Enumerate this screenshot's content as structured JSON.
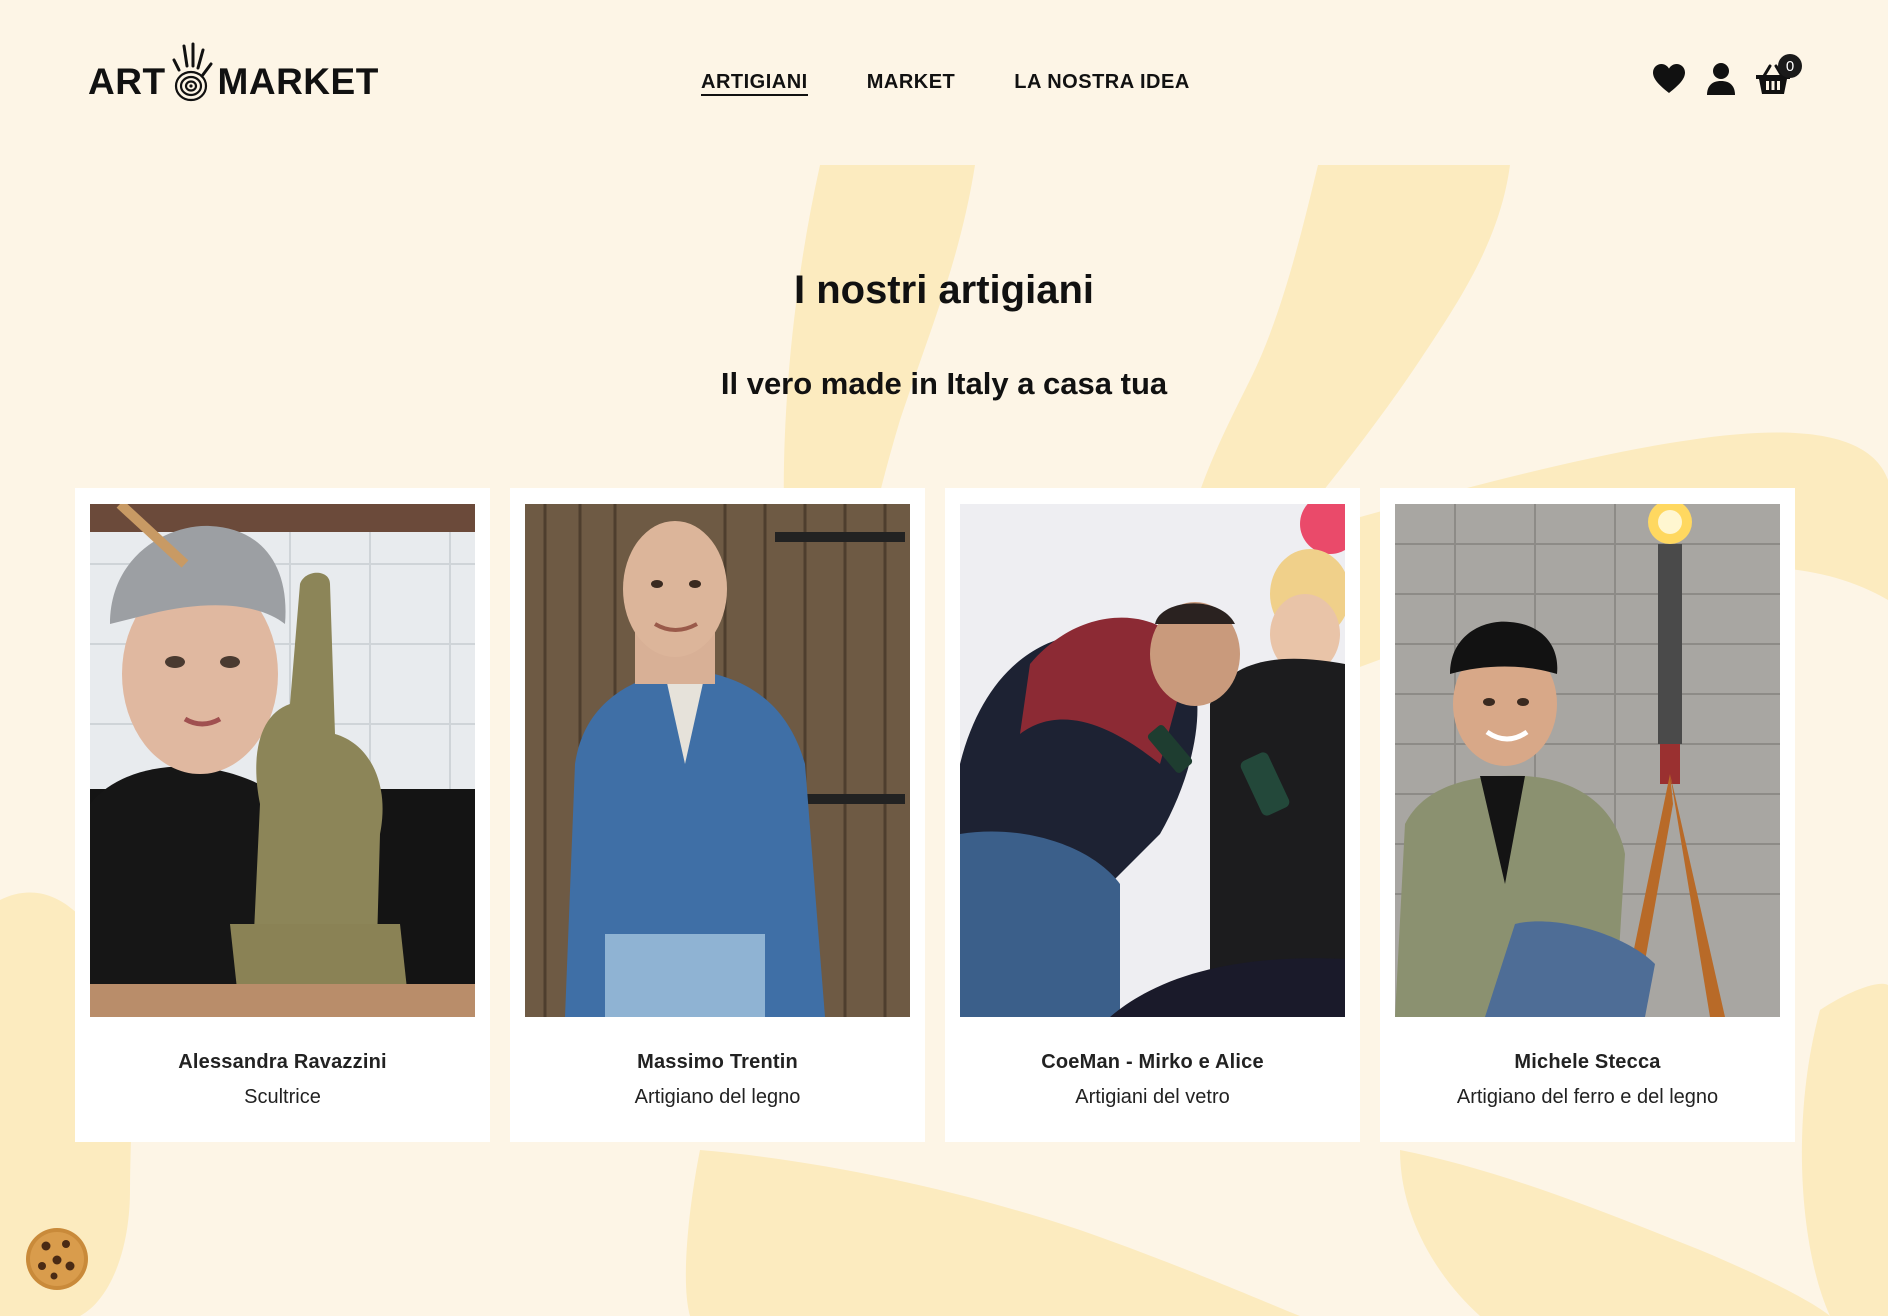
{
  "brand": {
    "left": "ART",
    "right": "MARKET"
  },
  "nav": {
    "items": [
      {
        "label": "ARTIGIANI",
        "active": true
      },
      {
        "label": "MARKET",
        "active": false
      },
      {
        "label": "LA NOSTRA IDEA",
        "active": false
      }
    ]
  },
  "header_icons": {
    "wishlist": "heart-icon",
    "account": "user-icon",
    "cart": "basket-icon",
    "cart_count": "0"
  },
  "hero": {
    "title": "I nostri artigiani",
    "subtitle": "Il vero made in Italy a casa tua"
  },
  "artisans": [
    {
      "name": "Alessandra Ravazzini",
      "role": "Scultrice"
    },
    {
      "name": "Massimo Trentin",
      "role": "Artigiano del legno"
    },
    {
      "name": "CoeMan - Mirko e Alice",
      "role": "Artigiani del vetro"
    },
    {
      "name": "Michele Stecca",
      "role": "Artigiano del ferro e del legno"
    }
  ],
  "colors": {
    "background": "#fdf5e6",
    "blob": "#fcebbf",
    "card": "#ffffff",
    "text": "#111111"
  },
  "cookie": {
    "icon": "cookie-icon"
  }
}
